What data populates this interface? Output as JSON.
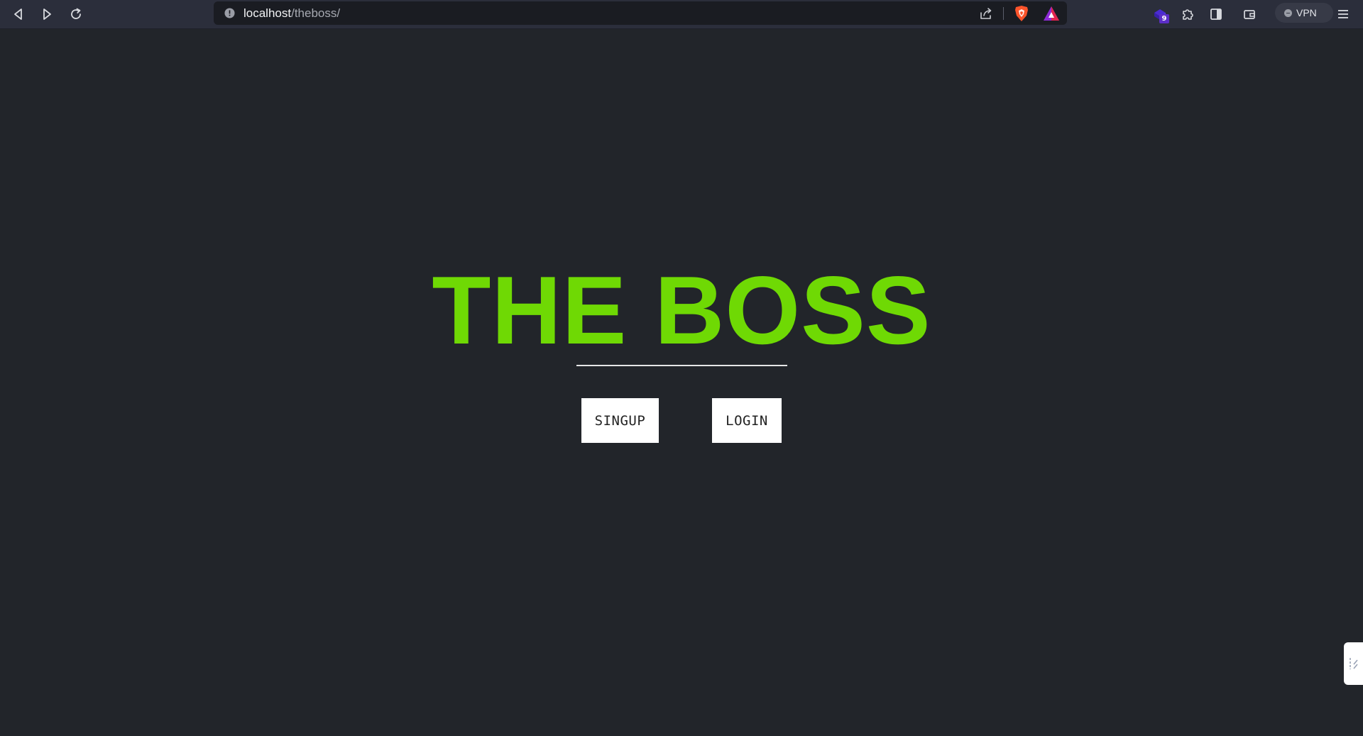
{
  "browser": {
    "url": {
      "host": "localhost",
      "path": "/theboss/"
    },
    "extension_badge": "9",
    "vpn_label": "VPN",
    "icons": {
      "back": "back-arrow-icon",
      "forward": "forward-arrow-icon",
      "reload": "reload-icon",
      "site_info": "info-icon",
      "share": "share-icon",
      "shields": "brave-shields-icon",
      "rewards": "brave-rewards-icon",
      "extension": "extension-app-icon",
      "extensions": "puzzle-icon",
      "sidebar": "sidebar-icon",
      "wallet": "wallet-icon",
      "menu": "hamburger-menu-icon"
    }
  },
  "page": {
    "title": "THE BOSS",
    "buttons": {
      "signup": "SINGUP",
      "login": "LOGIN"
    },
    "colors": {
      "background": "#22252a",
      "title": "#6fd904",
      "button_bg": "#ffffff"
    }
  }
}
